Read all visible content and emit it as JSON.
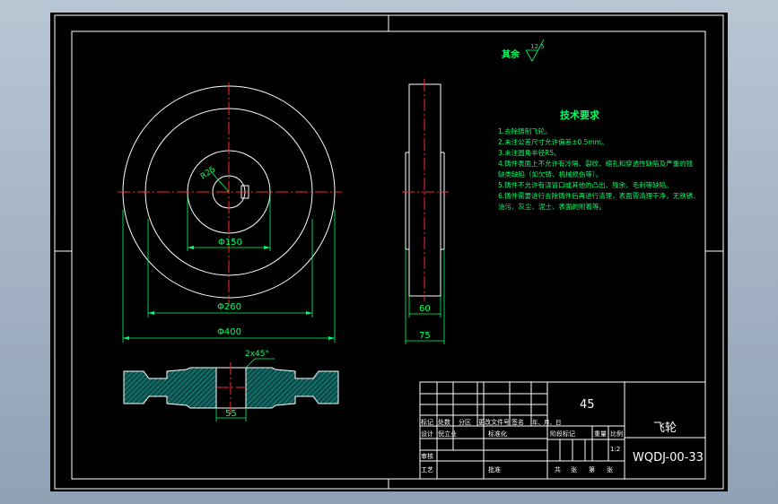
{
  "drawing": {
    "roughness_label": "其余",
    "roughness_value": "12.5",
    "tech_title": "技术要求",
    "tech_notes": [
      "1.去除铸制飞轮。",
      "2.未注公差尺寸允许偏差±0.5mm。",
      "3.未注圆角半径R5。",
      "4.铸件表面上不允许有冷隔、裂纹、缩孔和穿透性缺陷及严重的残",
      "  缺类缺陷（如欠铸、机械损伤等）。",
      "5.铸件不允许有浇冒口或其他的凸出、残余、毛刺等缺陷。",
      "6.铸件需要进行去除铸件后再进行清理，表面需清理干净，无铁锈、",
      "  油污、灰尘、泥土、表面的附着等。"
    ],
    "dims": {
      "keyway_radius": "R25",
      "d150": "Φ150",
      "d260": "Φ260",
      "d400": "Φ400",
      "w60": "60",
      "w75": "75",
      "chamfer": "2x45°",
      "w55": "55"
    }
  },
  "title_block": {
    "material": "45",
    "part_name": "飞轮",
    "drawing_no": "WQDJ-00-33",
    "scale_value": "1:2",
    "row_labels": [
      "标记",
      "处数",
      "分区",
      "更改文件号",
      "签名",
      "年、月、日"
    ],
    "design_labels": [
      "设计",
      "倪立业",
      "标准化"
    ],
    "stage_labels": [
      "阶段标记",
      "重量",
      "比例"
    ],
    "review_label": "审核",
    "craft_label": "工艺",
    "approve_label": "批准",
    "sheet_labels": [
      "共",
      "张",
      "第",
      "张"
    ]
  }
}
